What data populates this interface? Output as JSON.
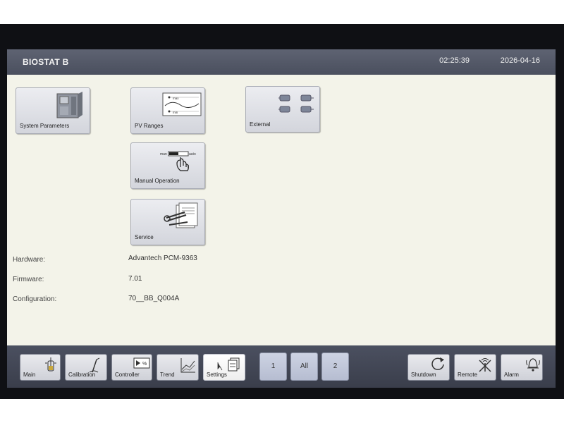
{
  "header": {
    "title": "BIOSTAT B",
    "time": "02:25:39",
    "date": "2026-04-16"
  },
  "tiles": {
    "system_parameters": "System Parameters",
    "pv_ranges": "PV Ranges",
    "external": "External",
    "manual_operation": "Manual Operation",
    "service": "Service"
  },
  "tile_icon_text": {
    "max": "max",
    "min": "min",
    "man": "man",
    "auto": "auto"
  },
  "info": {
    "hardware_label": "Hardware:",
    "hardware_value": "Advantech PCM-9363",
    "firmware_label": "Firmware:",
    "firmware_value": "7.01",
    "configuration_label": "Configuration:",
    "configuration_value": "70__BB_Q004A"
  },
  "nav": {
    "main": "Main",
    "calibration": "Calibration",
    "controller": "Controller",
    "trend": "Trend",
    "settings": "Settings",
    "page_1": "1",
    "page_all": "All",
    "page_2": "2",
    "shutdown": "Shutdown",
    "remote": "Remote",
    "alarm": "Alarm",
    "controller_icon_text": "%"
  },
  "icons": {
    "system_parameters": "bioreactor-icon",
    "pv_ranges": "range-chart-icon",
    "external": "connector-icon",
    "manual_operation": "hand-switch-icon",
    "service": "tools-icon",
    "main": "vessel-icon",
    "calibration": "probe-icon",
    "controller": "controller-icon",
    "trend": "trend-icon",
    "settings": "settings-icon",
    "shutdown": "power-icon",
    "remote": "remote-off-icon",
    "alarm": "bell-icon"
  },
  "colors": {
    "screen_bg": "#f3f3e9",
    "titlebar": "#525766",
    "navbar": "#434755",
    "page_button": "#c3c9db",
    "bezel": "#0f1014"
  }
}
